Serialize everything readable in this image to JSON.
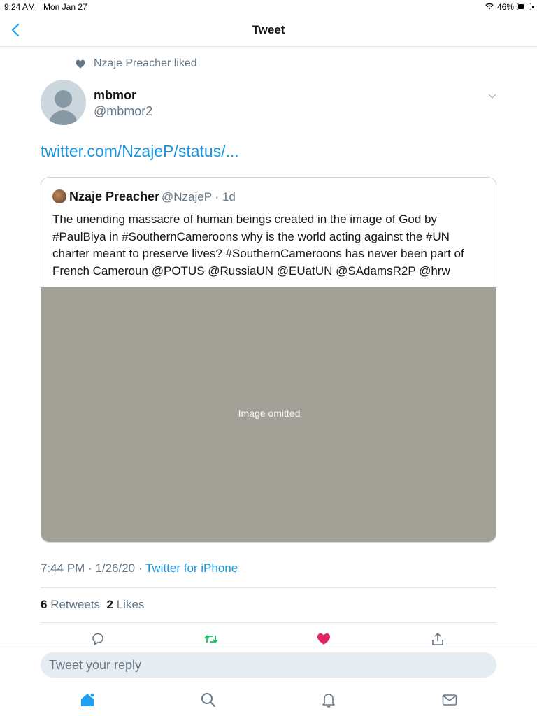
{
  "status_bar": {
    "time": "9:24 AM",
    "date": "Mon Jan 27",
    "battery": "46%",
    "battery_level": 0.46
  },
  "nav": {
    "back_icon": "chevron-left-icon",
    "title": "Tweet"
  },
  "social_context": {
    "icon": "heart-icon",
    "text": "Nzaje Preacher liked"
  },
  "tweet": {
    "author_name": "mbmor",
    "author_handle": "@mbmor2",
    "link_text": "twitter.com/NzajeP/status/...",
    "timestamp": "7:44 PM · 1/26/20 · ",
    "source": "Twitter for iPhone"
  },
  "quoted_tweet": {
    "author_name": "Nzaje Preacher",
    "author_handle": "@NzajeP · 1d",
    "text": "The unending massacre of human beings created in the image of God by #PaulBiya in #SouthernCameroons why is the world acting against the #UN charter meant to preserve lives? #SouthernCameroons has never been part of French Cameroun @POTUS @RussiaUN @EUatUN @SAdamsR2P @hrw",
    "media_label": "Image omitted"
  },
  "stats": {
    "retweets_count": "6",
    "retweets_label": " Retweets",
    "likes_count": "2",
    "likes_label": " Likes"
  },
  "actions": [
    {
      "icon": "reply-icon",
      "color": "#657786"
    },
    {
      "icon": "retweet-icon",
      "color": "#17bf63"
    },
    {
      "icon": "like-icon",
      "color": "#e0245e",
      "active": true
    },
    {
      "icon": "share-icon",
      "color": "#657786"
    }
  ],
  "reply": {
    "placeholder": "Tweet your reply"
  },
  "tab_bar": [
    {
      "icon": "home-icon",
      "active": true
    },
    {
      "icon": "search-icon"
    },
    {
      "icon": "notifications-icon"
    },
    {
      "icon": "messages-icon"
    }
  ],
  "colors": {
    "accent": "#1da1f2",
    "link": "#1b95e0",
    "like": "#e0245e",
    "retweet": "#17bf63",
    "secondary_text": "#657786"
  }
}
